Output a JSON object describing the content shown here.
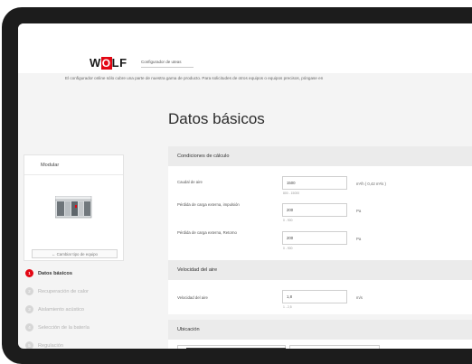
{
  "brand": {
    "logo_left": "W",
    "logo_mid": "LF",
    "app_title": "Configurador de uteas",
    "accent": "#e30613"
  },
  "notice": "El configurador online sólo cubre una parte de nuestra gama de producto. Para solicitudes de otros equipos o equipos precisos, póngase en",
  "page_title": "Datos básicos",
  "sidebar": {
    "model_label": "Modular",
    "change_button": "← Cambiar tipo de equipo",
    "steps": [
      {
        "num": "1",
        "label": "Datos básicos",
        "active": true
      },
      {
        "num": "2",
        "label": "Recuperación de calor",
        "active": false
      },
      {
        "num": "3",
        "label": "Aislamiento acústico",
        "active": false
      },
      {
        "num": "4",
        "label": "Selección de la batería",
        "active": false
      },
      {
        "num": "5",
        "label": "Regulación",
        "active": false
      }
    ]
  },
  "sections": {
    "calc": {
      "title": "Condiciones de cálculo",
      "rows": [
        {
          "label": "Caudal de aire",
          "value": "1500",
          "unit": "m³/h ( 0,42 m³/s )",
          "hint": "800 - 15000"
        },
        {
          "label": "Pérdida de carga externa, impulsión",
          "value": "200",
          "unit": "Pa",
          "hint": "0 - 900"
        },
        {
          "label": "Pérdida de carga externa, Retorno",
          "value": "200",
          "unit": "Pa",
          "hint": "0 - 900"
        }
      ]
    },
    "velocity": {
      "title": "Velocidad del aire",
      "rows": [
        {
          "label": "Velocidad del aire",
          "value": "1,8",
          "unit": "m/s",
          "hint": "1 - 2,5"
        }
      ]
    },
    "location": {
      "title": "Ubicación"
    }
  }
}
